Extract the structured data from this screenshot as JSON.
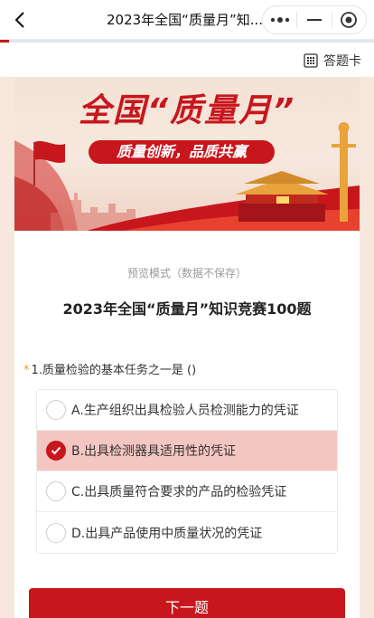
{
  "nav": {
    "title": "2023年全国“质量月”知...",
    "more_icon": "more-dots-icon",
    "minimize_icon": "minimize-icon",
    "close_icon": "target-close-icon"
  },
  "toolbar": {
    "answer_card_label": "答题卡",
    "answer_card_icon": "grid-icon"
  },
  "banner": {
    "headline": "全国“质量月”",
    "slogan": "质量创新，品质共赢"
  },
  "quiz": {
    "mode_note": "预览模式（数据不保存）",
    "title": "2023年全国“质量月”知识竞赛100题",
    "question": {
      "required_mark": "*",
      "text": "1.质量检验的基本任务之一是 ()"
    },
    "options": [
      {
        "label": "A.生产组织出具检验人员检测能力的凭证",
        "selected": false
      },
      {
        "label": "B.出具检测器具适用性的凭证",
        "selected": true
      },
      {
        "label": "C.出具质量符合要求的产品的检验凭证",
        "selected": false
      },
      {
        "label": "D.出具产品使用中质量状况的凭证",
        "selected": false
      }
    ],
    "next_label": "下一题"
  },
  "colors": {
    "accent": "#c8161d",
    "selected_bg": "#f4c6c2",
    "page_bg": "#f7e7dc"
  }
}
